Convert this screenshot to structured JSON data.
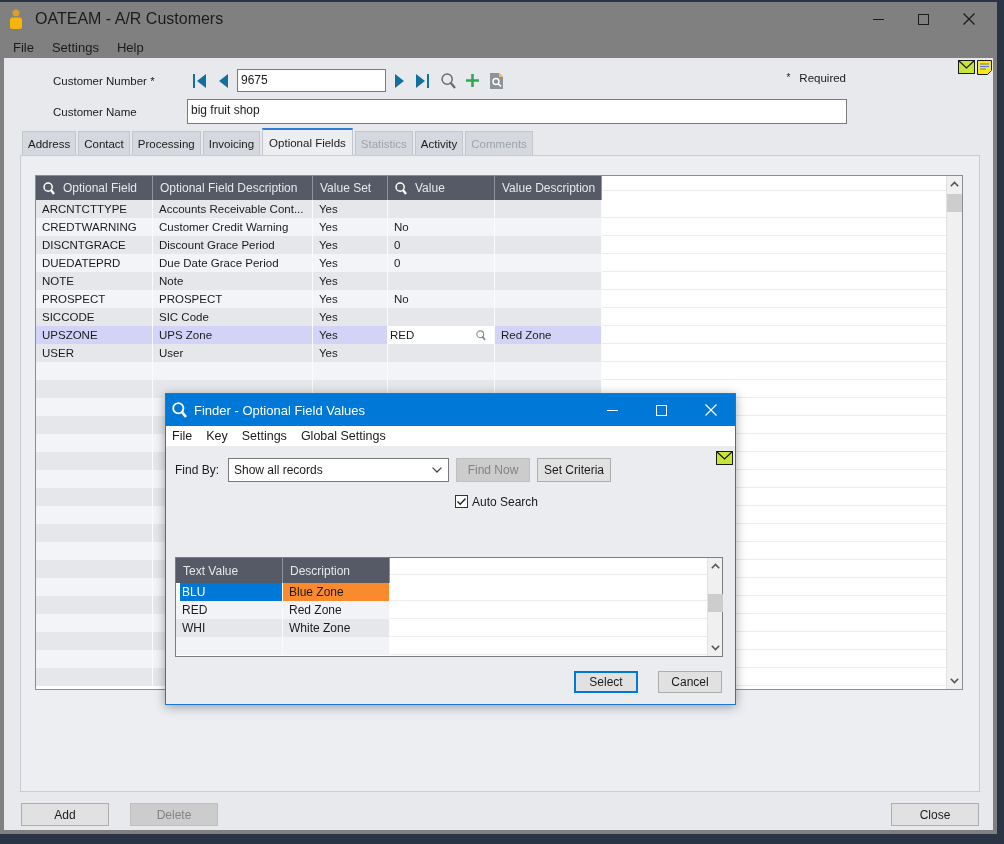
{
  "window": {
    "title": "OATEAM - A/R Customers"
  },
  "menu": [
    {
      "label": "File"
    },
    {
      "label": "Settings"
    },
    {
      "label": "Help"
    }
  ],
  "customer": {
    "number_label": "Customer Number *",
    "number": "9675",
    "name_label": "Customer Name",
    "name": "big fruit shop"
  },
  "required_legend": {
    "mark": "*",
    "text": "Required"
  },
  "tabs": [
    {
      "label": "Address",
      "selected": false,
      "disabled": false
    },
    {
      "label": "Contact",
      "selected": false,
      "disabled": false
    },
    {
      "label": "Processing",
      "selected": false,
      "disabled": false
    },
    {
      "label": "Invoicing",
      "selected": false,
      "disabled": false
    },
    {
      "label": "Optional Fields",
      "selected": true,
      "disabled": false
    },
    {
      "label": "Statistics",
      "selected": false,
      "disabled": true
    },
    {
      "label": "Activity",
      "selected": false,
      "disabled": false
    },
    {
      "label": "Comments",
      "selected": false,
      "disabled": true
    }
  ],
  "optional_fields": {
    "columns": [
      {
        "label": "Optional Field",
        "searchable": true
      },
      {
        "label": "Optional Field Description",
        "searchable": false
      },
      {
        "label": "Value Set",
        "searchable": false
      },
      {
        "label": "Value",
        "searchable": true
      },
      {
        "label": "Value Description",
        "searchable": false
      }
    ],
    "rows": [
      {
        "field": "ARCNTCTTYPE",
        "description": "Accounts Receivable Cont...",
        "value_set": "Yes",
        "selected": false
      },
      {
        "field": "CREDTWARNING",
        "description": "Customer Credit Warning",
        "value_set": "Yes",
        "value": "No",
        "selected": false
      },
      {
        "field": "DISCNTGRACE",
        "description": "Discount Grace Period",
        "value_set": "Yes",
        "value": "0",
        "selected": false
      },
      {
        "field": "DUEDATEPRD",
        "description": "Due Date Grace Period",
        "value_set": "Yes",
        "value": "0",
        "selected": false
      },
      {
        "field": "NOTE",
        "description": "Note",
        "value_set": "Yes",
        "selected": false
      },
      {
        "field": "PROSPECT",
        "description": "PROSPECT",
        "value_set": "Yes",
        "value": "No",
        "selected": false
      },
      {
        "field": "SICCODE",
        "description": "SIC Code",
        "value_set": "Yes",
        "selected": false
      },
      {
        "field": "UPSZONE",
        "description": "UPS Zone",
        "value_set": "Yes",
        "value": "RED",
        "value_description": "Red Zone",
        "selected": true
      },
      {
        "field": "USER",
        "description": "User",
        "value_set": "Yes",
        "selected": false
      }
    ]
  },
  "finder": {
    "title": "Finder - Optional Field Values",
    "menu": [
      {
        "label": "File"
      },
      {
        "label": "Key"
      },
      {
        "label": "Settings"
      },
      {
        "label": "Global Settings"
      }
    ],
    "find_by": {
      "label": "Find By:",
      "value": "Show all records"
    },
    "buttons": [
      {
        "label": "Find Now",
        "disabled": true
      },
      {
        "label": "Set Criteria",
        "disabled": false
      }
    ],
    "auto_search": {
      "label": "Auto Search",
      "checked": true
    },
    "results": {
      "columns": [
        {
          "label": "Text Value"
        },
        {
          "label": "Description"
        }
      ],
      "rows": [
        {
          "text_value": "BLU",
          "description": "Blue Zone",
          "selected": true
        },
        {
          "text_value": "RED",
          "description": "Red Zone",
          "selected": false
        },
        {
          "text_value": "WHI",
          "description": "White Zone",
          "selected": false
        }
      ]
    },
    "actions": [
      {
        "label": "Select",
        "default": true
      },
      {
        "label": "Cancel",
        "default": false
      }
    ]
  },
  "footer": {
    "left": [
      {
        "label": "Add",
        "disabled": false
      },
      {
        "label": "Delete",
        "disabled": true
      }
    ],
    "right": [
      {
        "label": "Close",
        "disabled": false
      }
    ]
  }
}
